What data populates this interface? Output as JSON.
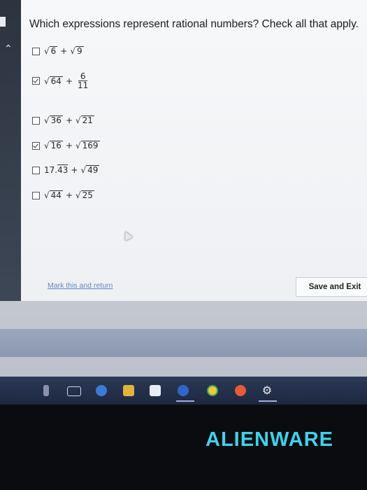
{
  "question": "Which expressions represent rational numbers? Check all that apply.",
  "options": [
    {
      "checked": false,
      "a": "6",
      "op": "+",
      "b": "9"
    },
    {
      "checked": true,
      "a": "64",
      "op": "+",
      "num": "6",
      "den": "11"
    },
    {
      "checked": false,
      "a": "36",
      "op": "+",
      "b": "21"
    },
    {
      "checked": true,
      "a": "16",
      "op": "+",
      "b": "169"
    },
    {
      "checked": false,
      "dec_int": "17.",
      "dec_rep": "43",
      "op": "+",
      "b": "49"
    },
    {
      "checked": false,
      "a": "44",
      "op": "+",
      "b": "25"
    }
  ],
  "radical_symbol": "√",
  "footer": {
    "mark_link": "Mark this and return",
    "save_button": "Save and Exit"
  },
  "taskbar_icons": [
    "microphone-icon",
    "task-view-icon",
    "cortana-icon",
    "file-explorer-icon",
    "store-icon",
    "steam-icon",
    "chrome-icon",
    "media-icon",
    "settings-icon"
  ],
  "brand": "ALIENWARE",
  "colors": {
    "brand": "#3fd1ea",
    "link": "#3b6fb4",
    "taskbar": "#1d2740"
  }
}
